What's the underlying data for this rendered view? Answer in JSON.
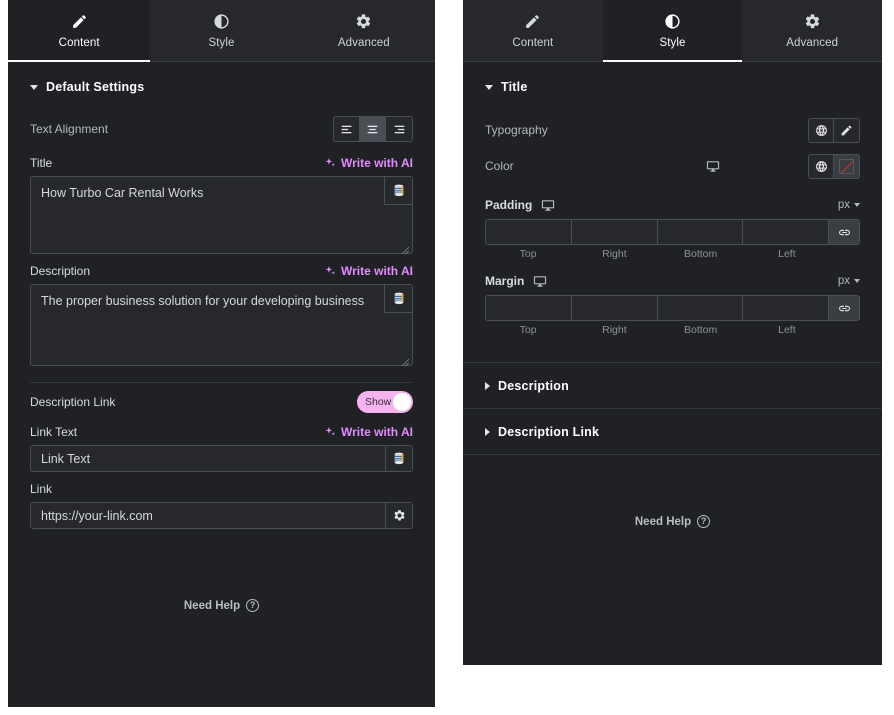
{
  "panels": {
    "left": {
      "tabs": [
        {
          "label": "Content",
          "icon": "pencil-icon",
          "active": true
        },
        {
          "label": "Style",
          "icon": "contrast-icon",
          "active": false
        },
        {
          "label": "Advanced",
          "icon": "gear-icon",
          "active": false
        }
      ],
      "section": {
        "title": "Default Settings",
        "expanded": true
      },
      "text_alignment": {
        "label": "Text Alignment",
        "options": [
          "align-left",
          "align-center",
          "align-right"
        ],
        "selected": "align-center"
      },
      "title_field": {
        "label": "Title",
        "ai_label": "Write with AI",
        "value": "How Turbo Car Rental Works",
        "dynamic_icon": "database-icon"
      },
      "description_field": {
        "label": "Description",
        "ai_label": "Write with AI",
        "value": "The proper business solution for your developing business",
        "dynamic_icon": "database-icon"
      },
      "description_link": {
        "label": "Description Link",
        "toggle_state": "Show",
        "toggle_on": true
      },
      "link_text_field": {
        "label": "Link Text",
        "ai_label": "Write with AI",
        "value": "Link Text",
        "dynamic_icon": "database-icon"
      },
      "link_field": {
        "label": "Link",
        "value": "https://your-link.com",
        "settings_icon": "gear-icon"
      },
      "need_help": "Need Help"
    },
    "right": {
      "tabs": [
        {
          "label": "Content",
          "icon": "pencil-icon",
          "active": false
        },
        {
          "label": "Style",
          "icon": "contrast-icon",
          "active": true
        },
        {
          "label": "Advanced",
          "icon": "gear-icon",
          "active": false
        }
      ],
      "section": {
        "title": "Title",
        "expanded": true
      },
      "typography": {
        "label": "Typography",
        "globe_icon": "globe-icon",
        "edit_icon": "pencil-icon"
      },
      "color": {
        "label": "Color",
        "device_icon": "monitor-icon",
        "globe_icon": "globe-icon",
        "swatch": "none"
      },
      "padding": {
        "label": "Padding",
        "device_icon": "monitor-icon",
        "unit": "px",
        "values": [
          "",
          "",
          "",
          ""
        ],
        "sides": [
          "Top",
          "Right",
          "Bottom",
          "Left"
        ],
        "link_icon": "link-icon"
      },
      "margin": {
        "label": "Margin",
        "device_icon": "monitor-icon",
        "unit": "px",
        "values": [
          "",
          "",
          "",
          ""
        ],
        "sides": [
          "Top",
          "Right",
          "Bottom",
          "Left"
        ],
        "link_icon": "link-icon"
      },
      "collapsed_sections": [
        {
          "title": "Description"
        },
        {
          "title": "Description Link"
        }
      ],
      "need_help": "Need Help"
    }
  },
  "colors": {
    "panel_bg": "#1f2124",
    "tab_bg": "#26282b",
    "accent_ai": "#e28bff",
    "toggle_on": "#f5b4f0",
    "border": "#4b4e54",
    "swatch_none_line": "#d4352f"
  }
}
